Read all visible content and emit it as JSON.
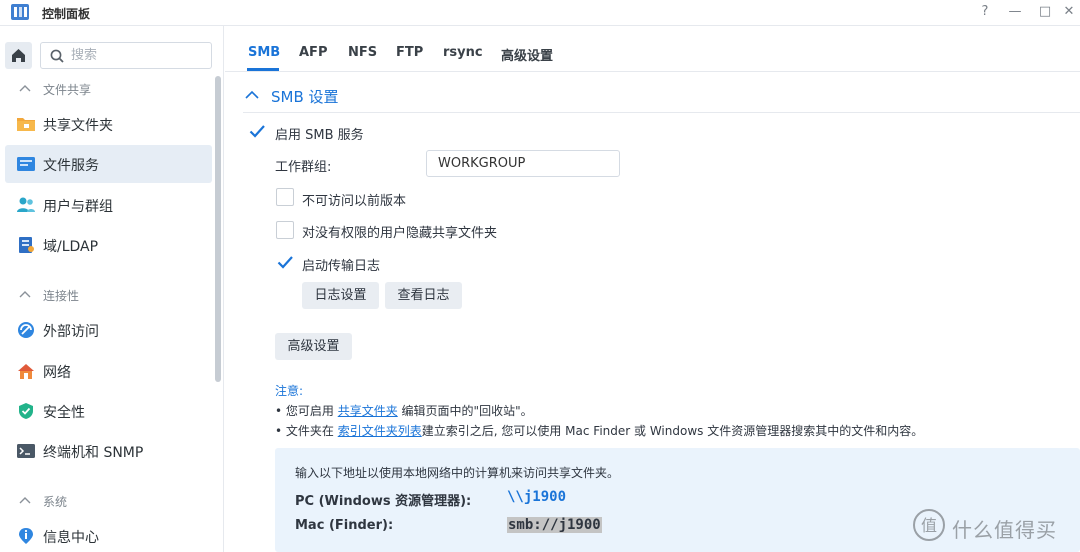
{
  "window": {
    "title": "控制面板",
    "controls": [
      "?",
      "—",
      "□",
      "✕"
    ]
  },
  "sidebar": {
    "search_placeholder": "搜索",
    "groups": [
      {
        "label": "文件共享"
      },
      {
        "label": "连接性"
      },
      {
        "label": "系统"
      }
    ],
    "items": [
      {
        "label": "共享文件夹",
        "icon": "folder-icon"
      },
      {
        "label": "文件服务",
        "icon": "file-services-icon",
        "active": true
      },
      {
        "label": "用户与群组",
        "icon": "users-icon"
      },
      {
        "label": "域/LDAP",
        "icon": "domain-icon"
      },
      {
        "label": "外部访问",
        "icon": "external-access-icon"
      },
      {
        "label": "网络",
        "icon": "network-icon"
      },
      {
        "label": "安全性",
        "icon": "shield-icon"
      },
      {
        "label": "终端机和 SNMP",
        "icon": "terminal-icon"
      },
      {
        "label": "信息中心",
        "icon": "info-icon"
      }
    ]
  },
  "tabs": [
    {
      "label": "SMB",
      "active": true
    },
    {
      "label": "AFP"
    },
    {
      "label": "NFS"
    },
    {
      "label": "FTP"
    },
    {
      "label": "rsync"
    },
    {
      "label": "高级设置"
    }
  ],
  "smb": {
    "section_title": "SMB 设置",
    "enable_label": "启用 SMB 服务",
    "enable_checked": true,
    "workgroup_label": "工作群组:",
    "workgroup_value": "WORKGROUP",
    "options": [
      {
        "label": "不可访问以前版本",
        "checked": false
      },
      {
        "label": "对没有权限的用户隐藏共享文件夹",
        "checked": false
      },
      {
        "label": "启动传输日志",
        "checked": true
      }
    ],
    "log_settings_btn": "日志设置",
    "view_log_btn": "查看日志",
    "advanced_btn": "高级设置"
  },
  "notes": {
    "title": "注意:",
    "line1_pre": "• 您可启用 ",
    "line1_link": "共享文件夹",
    "line1_post": " 编辑页面中的\"回收站\"。",
    "line2_pre": "• 文件夹在 ",
    "line2_link": "索引文件夹列表",
    "line2_post": "建立索引之后, 您可以使用 Mac Finder 或 Windows 文件资源管理器搜索其中的文件和内容。"
  },
  "access_info": {
    "description": "输入以下地址以使用本地网络中的计算机来访问共享文件夹。",
    "pc_label": "PC (Windows 资源管理器):",
    "pc_value": "\\\\j1900",
    "mac_label": "Mac (Finder):",
    "mac_value": "smb://j1900"
  },
  "watermark": {
    "text": "什么值得买",
    "logo_char": "值"
  },
  "colors": {
    "accent": "#1a74d8",
    "active_bg": "#e6edf5",
    "info_bg": "#eaf3fc"
  }
}
